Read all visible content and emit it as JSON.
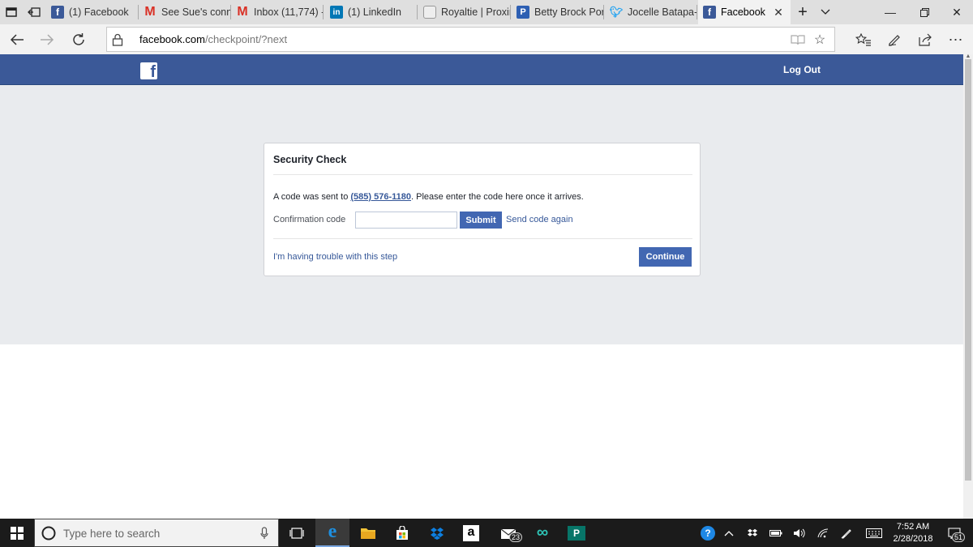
{
  "browser": {
    "tabs": [
      {
        "label": "(1) Facebook",
        "icon": "facebook-icon"
      },
      {
        "label": "See Sue's conne",
        "icon": "gmail-icon"
      },
      {
        "label": "Inbox (11,774) -",
        "icon": "gmail-icon"
      },
      {
        "label": "(1) LinkedIn",
        "icon": "linkedin-icon"
      },
      {
        "label": "Royaltie | Proxir",
        "icon": "royaltie-icon"
      },
      {
        "label": "Betty Brock Por",
        "icon": "page-icon"
      },
      {
        "label": "Jocelle Batapa-S",
        "icon": "twitter-icon"
      },
      {
        "label": "Facebook",
        "icon": "facebook-icon",
        "active": true
      }
    ],
    "url_host": "facebook.com",
    "url_path": "/checkpoint/?next"
  },
  "header": {
    "logout_label": "Log Out"
  },
  "card": {
    "title": "Security Check",
    "message_prefix": "A code was sent to ",
    "phone": "(585) 576-1180",
    "message_suffix": ". Please enter the code here once it arrives.",
    "confirmation_label": "Confirmation code",
    "confirmation_value": "",
    "submit_label": "Submit",
    "send_again_label": "Send code again",
    "trouble_label": "I'm having trouble with this step",
    "continue_label": "Continue"
  },
  "taskbar": {
    "search_placeholder": "Type here to search",
    "mail_badge": "23",
    "time": "7:52 AM",
    "date": "2/28/2018",
    "notification_count": "51"
  },
  "colors": {
    "facebook_blue": "#3b5998",
    "button_blue": "#4267b2",
    "link_blue": "#365899",
    "page_gray": "#e9ebee"
  }
}
